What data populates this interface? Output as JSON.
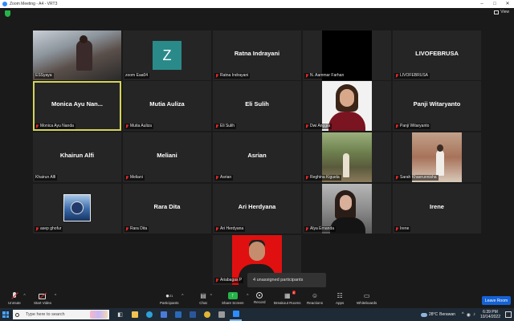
{
  "window": {
    "title": "Zoom Meeting - A4 - VRT3"
  },
  "view_button": {
    "label": "View"
  },
  "participants": [
    {
      "name": "ESSyaya",
      "display": "",
      "photo": "city",
      "muted": false
    },
    {
      "name": "zoom Eaa04",
      "display": "",
      "photo": "z",
      "letter": "Z",
      "muted": false
    },
    {
      "name": "Ratna Indrayani",
      "display": "Ratna Indrayani",
      "photo": "",
      "muted": true
    },
    {
      "name": "N. Aammar Farhan",
      "display": "",
      "photo": "black",
      "muted": true
    },
    {
      "name": "LIVOFEBRUSA",
      "display": "LIVOFEBRUSA",
      "photo": "",
      "muted": true
    },
    {
      "name": "Monica Ayu Nanda",
      "display": "Monica Ayu Nan...",
      "photo": "",
      "muted": true,
      "speaker": true
    },
    {
      "name": "Mutia Auliza",
      "display": "Mutia Auliza",
      "photo": "",
      "muted": true
    },
    {
      "name": "Eli Sulih",
      "display": "Eli Sulih",
      "photo": "",
      "muted": true
    },
    {
      "name": "Dwi Anggia",
      "display": "",
      "photo": "dwi",
      "muted": true
    },
    {
      "name": "Panji Witaryanto",
      "display": "Panji Witaryanto",
      "photo": "",
      "muted": true
    },
    {
      "name": "Khairun Alfi",
      "display": "Khairun Alfi",
      "photo": "",
      "muted": false
    },
    {
      "name": "Meliani",
      "display": "Meliani",
      "photo": "",
      "muted": true
    },
    {
      "name": "Asrian",
      "display": "Asrian",
      "photo": "",
      "muted": true
    },
    {
      "name": "Reghina Kiguela",
      "display": "",
      "photo": "forest",
      "muted": true
    },
    {
      "name": "Sarah Khaerunnisha",
      "display": "",
      "photo": "rust",
      "muted": true
    },
    {
      "name": "asep ghofur",
      "display": "",
      "photo": "asep",
      "muted": true
    },
    {
      "name": "Rara Dita",
      "display": "Rara Dita",
      "photo": "",
      "muted": true
    },
    {
      "name": "Ari Herdyana",
      "display": "Ari Herdyana",
      "photo": "",
      "muted": true
    },
    {
      "name": "Alya Ernanda",
      "display": "",
      "photo": "alya",
      "muted": true
    },
    {
      "name": "Irene",
      "display": "Irene",
      "photo": "",
      "muted": true
    },
    {
      "name": "Ariabagas P",
      "display": "",
      "photo": "red",
      "muted": true
    }
  ],
  "unassigned": {
    "text": "4 unassigned participants"
  },
  "toolbar": {
    "unmute": "Unmute",
    "start_video": "Start Video",
    "participants": "Participants",
    "participants_count": "21",
    "chat": "Chat",
    "share_screen": "Share Screen",
    "record": "Record",
    "breakout_rooms": "Breakout Rooms",
    "breakout_badge": "4",
    "reactions": "Reactions",
    "apps": "Apps",
    "whiteboards": "Whiteboards",
    "leave": "Leave Room"
  },
  "taskbar": {
    "search_placeholder": "Type here to search",
    "weather_temp": "28°C",
    "weather_desc": "Berawan",
    "time": "6:39 PM",
    "date": "10/14/2022"
  }
}
